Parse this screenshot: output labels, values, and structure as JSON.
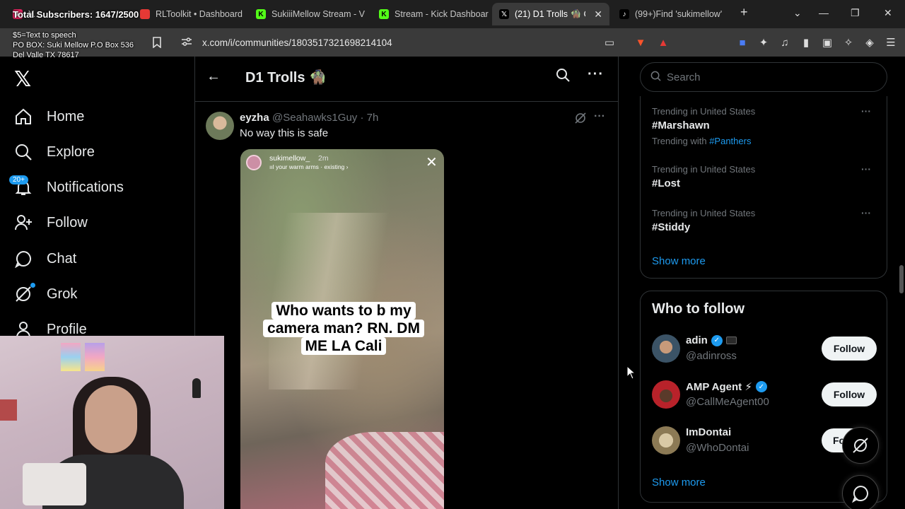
{
  "browser": {
    "tabs": [
      {
        "label": "Y...",
        "active": false,
        "favicon_color": "#e0245e",
        "favicon_icon": "youtube-icon"
      },
      {
        "label": "RLToolkit • Dashboard",
        "active": false,
        "favicon_color": "#e53935",
        "favicon_icon": "rltoolkit-icon"
      },
      {
        "label": "SukiiiMellow Stream - V",
        "active": false,
        "favicon_color": "#53fc18",
        "favicon_icon": "kick-icon",
        "favicon_text": "K"
      },
      {
        "label": "Stream - Kick Dashboar",
        "active": false,
        "favicon_color": "#53fc18",
        "favicon_icon": "kick-icon",
        "favicon_text": "K"
      },
      {
        "label": "(21) D1 Trolls 🧌 C",
        "active": true,
        "favicon_color": "#000000",
        "favicon_icon": "x-icon",
        "favicon_text": "𝕏"
      },
      {
        "label": "(99+)Find 'sukimellow'",
        "active": false,
        "favicon_color": "#000000",
        "favicon_icon": "tiktok-icon",
        "favicon_text": "♪"
      }
    ],
    "url": "x.com/i/communities/1803517321698214104",
    "new_tab": "+",
    "minimize": "—",
    "restore": "❐",
    "close": "✕"
  },
  "overlay": {
    "subscribers": "Total Subscribers: 1647/2500",
    "tts": "$5=Text to speech\nPO BOX: Suki Mellow P.O Box 536\nDel Valle TX 78617"
  },
  "nav": {
    "logo": "𝕏",
    "badge": "20+",
    "items": [
      {
        "label": "Home",
        "icon": "home-icon"
      },
      {
        "label": "Explore",
        "icon": "search-icon"
      },
      {
        "label": "Notifications",
        "icon": "bell-icon"
      },
      {
        "label": "Follow",
        "icon": "follow-icon"
      },
      {
        "label": "Chat",
        "icon": "chat-icon"
      },
      {
        "label": "Grok",
        "icon": "grok-icon"
      },
      {
        "label": "Profile",
        "icon": "profile-icon"
      }
    ]
  },
  "community": {
    "title": "D1 Trolls 🧌"
  },
  "post": {
    "name": "eyzha",
    "handle": "@Seahawks1Guy · 7h",
    "text": "No way this is safe",
    "story": {
      "user": "sukimellow_",
      "time": "2m",
      "music": "ııl your warm arms · existing ›",
      "caption": "Who wants to b my camera man? RN. DM ME LA Cali"
    }
  },
  "sidebar": {
    "search_placeholder": "Search",
    "trends": [
      {
        "meta": "Trending in United States",
        "name": "#Marshawn",
        "with_label": "Trending with",
        "with_tag": "#Panthers"
      },
      {
        "meta": "Trending in United States",
        "name": "#Lost"
      },
      {
        "meta": "Trending in United States",
        "name": "#Stiddy"
      }
    ],
    "show_more": "Show more",
    "who_to_follow": {
      "title": "Who to follow",
      "users": [
        {
          "name": "adin",
          "handle": "@adinross",
          "verified": true,
          "affiliate": true,
          "button": "Follow",
          "avatar_color": "#3b5366"
        },
        {
          "name": "AMP Agent ⚡",
          "handle": "@CallMeAgent00",
          "verified": true,
          "affiliate": false,
          "button": "Follow",
          "avatar_color": "#b8222a"
        },
        {
          "name": "ImDontai",
          "handle": "@WhoDontai",
          "verified": false,
          "affiliate": false,
          "button": "Fo",
          "avatar_color": "#8c7a55"
        }
      ],
      "show_more": "Show more"
    }
  }
}
